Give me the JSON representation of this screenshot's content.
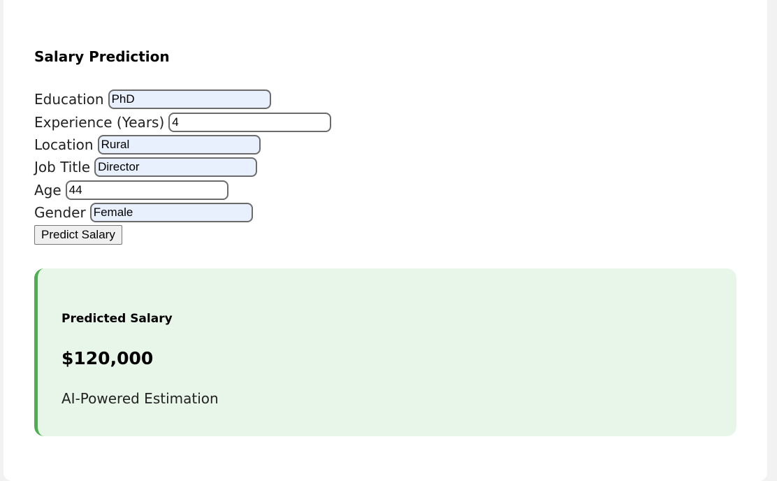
{
  "page": {
    "title": "Salary Prediction"
  },
  "form": {
    "fields": [
      {
        "label": "Education",
        "value": "PhD"
      },
      {
        "label": "Experience (Years)",
        "value": "4"
      },
      {
        "label": "Location",
        "value": "Rural"
      },
      {
        "label": "Job Title",
        "value": "Director"
      },
      {
        "label": "Age",
        "value": "44"
      },
      {
        "label": "Gender",
        "value": "Female"
      }
    ],
    "submit_label": "Predict Salary"
  },
  "result": {
    "label": "Predicted Salary",
    "value": "$120,000",
    "note": "AI-Powered Estimation"
  },
  "colors": {
    "result_background": "#e8f5e9",
    "result_accent": "#4caf50",
    "autofill_background": "#e8f0fe"
  }
}
